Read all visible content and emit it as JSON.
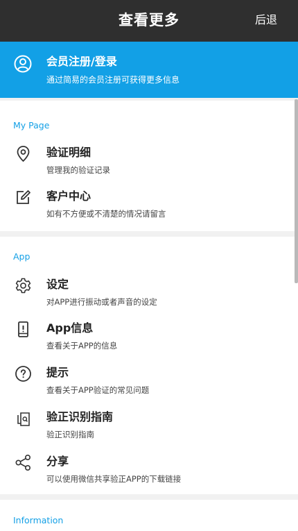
{
  "header": {
    "title": "查看更多",
    "back_label": "后退"
  },
  "member": {
    "title": "会员注册/登录",
    "subtitle": "通过简易的会员注册可获得更多信息",
    "icon": "user-icon"
  },
  "sections": {
    "my_page": {
      "label": "My Page",
      "items": [
        {
          "title": "验证明细",
          "subtitle": "管理我的验证记录",
          "icon": "location-pin-icon"
        },
        {
          "title": "客户中心",
          "subtitle": "如有不方便或不清楚的情况请留言",
          "icon": "edit-icon"
        }
      ]
    },
    "app": {
      "label": "App",
      "items": [
        {
          "title": "设定",
          "subtitle": "对APP进行振动或者声音的设定",
          "icon": "gear-icon"
        },
        {
          "title": "App信息",
          "subtitle": "查看关于APP的信息",
          "icon": "phone-info-icon"
        },
        {
          "title": "提示",
          "subtitle": "查看关于APP验证的常见问题",
          "icon": "question-icon"
        },
        {
          "title": "验正识别指南",
          "subtitle": "验正识别指南",
          "icon": "guide-icon"
        },
        {
          "title": "分享",
          "subtitle": "可以使用微信共享验正APP的下载链接",
          "icon": "share-icon"
        }
      ]
    },
    "information": {
      "label": "Information"
    }
  },
  "colors": {
    "header_bg": "#2f2f2f",
    "accent": "#12a0e6",
    "section_label": "#14a0e6",
    "divider": "#f1f1f1"
  }
}
